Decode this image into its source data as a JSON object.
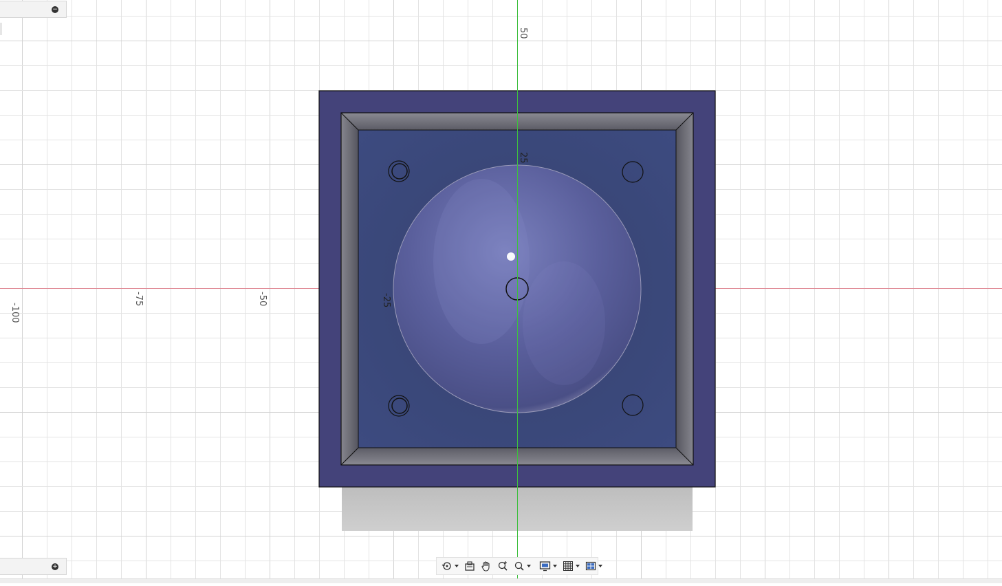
{
  "panels": {
    "top_toggle_icon": "minus-icon",
    "bottom_toggle_icon": "plus-icon"
  },
  "axes": {
    "x_axis_color": "#e07080",
    "y_axis_color": "#3fbf3f",
    "labels": {
      "x_m100": "-100",
      "x_m75": "-75",
      "x_m50": "-50",
      "y_50": "50",
      "y_25": "25",
      "x_m25": "-25"
    }
  },
  "model": {
    "body_color": "#44437a",
    "inner_color": "#39467a",
    "dome_color": "#5a5f9c"
  },
  "toolbar": {
    "items": [
      "orbit-icon",
      "look-at-icon",
      "pan-icon",
      "zoom-window-icon",
      "zoom-icon",
      "display-settings-icon",
      "grid-icon",
      "viewports-icon"
    ]
  }
}
